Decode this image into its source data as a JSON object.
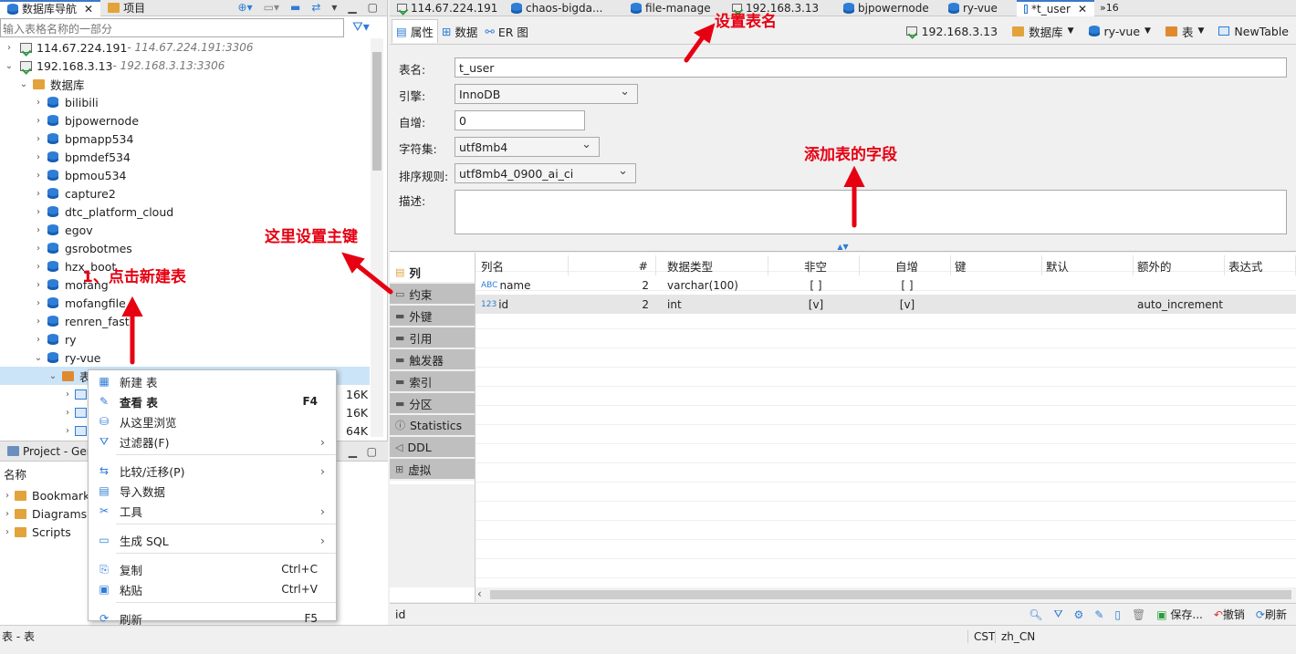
{
  "left_tabs": {
    "nav": "数据库导航",
    "project": "项目"
  },
  "filter_placeholder": "输入表格名称的一部分",
  "connections": [
    {
      "name": "114.67.224.191",
      "detail": " - 114.67.224.191:3306"
    },
    {
      "name": "192.168.3.13",
      "detail": " - 192.168.3.13:3306"
    }
  ],
  "db_folder": "数据库",
  "databases": [
    "bilibili",
    "bjpowernode",
    "bpmapp534",
    "bpmdef534",
    "bpmou534",
    "capture2",
    "dtc_platform_cloud",
    "egov",
    "gsrobotmes",
    "hzx_boot",
    "mofang",
    "mofangfile",
    "renren_fast",
    "ry",
    "ry-vue"
  ],
  "tables_folder": "表",
  "table_sizes": [
    "16K",
    "16K",
    "64K"
  ],
  "context_menu": [
    {
      "label": "新建 表",
      "shortcut": "",
      "arrow": false,
      "bold": false
    },
    {
      "label": "查看 表",
      "shortcut": "F4",
      "arrow": false,
      "bold": true
    },
    {
      "label": "从这里浏览",
      "shortcut": "",
      "arrow": false,
      "bold": false
    },
    {
      "label": "过滤器(F)",
      "shortcut": "",
      "arrow": true,
      "bold": false
    },
    {
      "sep": true
    },
    {
      "label": "比较/迁移(P)",
      "shortcut": "",
      "arrow": true,
      "bold": false
    },
    {
      "label": "导入数据",
      "shortcut": "",
      "arrow": false,
      "bold": false
    },
    {
      "label": "工具",
      "shortcut": "",
      "arrow": true,
      "bold": false
    },
    {
      "sep": true
    },
    {
      "label": "生成 SQL",
      "shortcut": "",
      "arrow": true,
      "bold": false
    },
    {
      "sep": true
    },
    {
      "label": "复制",
      "shortcut": "Ctrl+C",
      "arrow": false,
      "bold": false
    },
    {
      "label": "粘贴",
      "shortcut": "Ctrl+V",
      "arrow": false,
      "bold": false
    },
    {
      "sep": true
    },
    {
      "label": "刷新",
      "shortcut": "F5",
      "arrow": false,
      "bold": false
    }
  ],
  "project_panel": {
    "title": "Project - Ger",
    "col": "名称",
    "items": [
      "Bookmark",
      "Diagrams",
      "Scripts"
    ]
  },
  "editor_tabs": [
    "114.67.224.191",
    "chaos-bigda...",
    "file-manage",
    "192.168.3.13",
    "bjpowernode",
    "ry-vue",
    "*t_user"
  ],
  "editor_tabs_more": "»16",
  "sub_tabs": [
    "属性",
    "数据",
    "ER 图"
  ],
  "breadcrumb": [
    "192.168.3.13",
    "数据库",
    "ry-vue",
    "表",
    "NewTable"
  ],
  "form": {
    "name_label": "表名:",
    "name": "t_user",
    "engine_label": "引擎:",
    "engine": "InnoDB",
    "autoinc_label": "自增:",
    "autoinc": "0",
    "charset_label": "字符集:",
    "charset": "utf8mb4",
    "collation_label": "排序规则:",
    "collation": "utf8mb4_0900_ai_ci",
    "desc_label": "描述:"
  },
  "side_tabs": [
    "列",
    "约束",
    "外键",
    "引用",
    "触发器",
    "索引",
    "分区",
    "Statistics",
    "DDL",
    "虚拟"
  ],
  "grid": {
    "headers": [
      "列名",
      "#",
      "数据类型",
      "非空",
      "自增",
      "键",
      "默认",
      "额外的",
      "表达式"
    ],
    "rows": [
      {
        "type_icon": "ABC",
        "name": "name",
        "num": "2",
        "dtype": "varchar(100)",
        "notnull": "[ ]",
        "autoinc": "[ ]",
        "key": "",
        "default": "",
        "extra": "",
        "expr": ""
      },
      {
        "type_icon": "123",
        "name": "id",
        "num": "2",
        "dtype": "int",
        "notnull": "[v]",
        "autoinc": "[v]",
        "key": "",
        "default": "",
        "extra": "auto_increment",
        "expr": ""
      }
    ]
  },
  "bottom_field": "id",
  "bottom_actions": {
    "save": "保存...",
    "undo": "撤销",
    "refresh": "刷新"
  },
  "status": {
    "left": "表 - 表",
    "tz": "CST",
    "locale": "zh_CN"
  },
  "annotations": {
    "set_name": "设置表名",
    "add_fields": "添加表的字段",
    "set_pk": "这里设置主键",
    "new_table": "1、点击新建表"
  },
  "colors": {
    "accent": "#3c78c8",
    "annotation": "#e60012",
    "selection": "#cce4f7"
  }
}
